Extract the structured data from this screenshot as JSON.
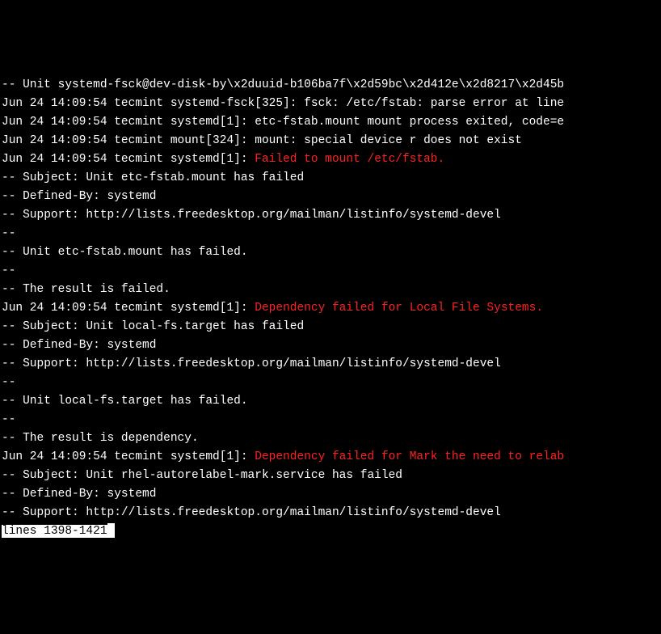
{
  "lines": [
    {
      "segments": [
        {
          "text": "-- Unit systemd-fsck@dev-disk-by\\x2duuid-b106ba7f\\x2d59bc\\x2d412e\\x2d8217\\x2d45b"
        }
      ]
    },
    {
      "segments": [
        {
          "text": "Jun 24 14:09:54 tecmint systemd-fsck[325]: fsck: /etc/fstab: parse error at line"
        }
      ]
    },
    {
      "segments": [
        {
          "text": "Jun 24 14:09:54 tecmint systemd[1]: etc-fstab.mount mount process exited, code=e"
        }
      ]
    },
    {
      "segments": [
        {
          "text": "Jun 24 14:09:54 tecmint mount[324]: mount: special device r does not exist"
        }
      ]
    },
    {
      "segments": [
        {
          "text": "Jun 24 14:09:54 tecmint systemd[1]: "
        },
        {
          "text": "Failed to mount /etc/fstab.",
          "class": "red"
        }
      ]
    },
    {
      "segments": [
        {
          "text": "-- Subject: Unit etc-fstab.mount has failed"
        }
      ]
    },
    {
      "segments": [
        {
          "text": "-- Defined-By: systemd"
        }
      ]
    },
    {
      "segments": [
        {
          "text": "-- Support: http://lists.freedesktop.org/mailman/listinfo/systemd-devel"
        }
      ]
    },
    {
      "segments": [
        {
          "text": "--"
        }
      ]
    },
    {
      "segments": [
        {
          "text": "-- Unit etc-fstab.mount has failed."
        }
      ]
    },
    {
      "segments": [
        {
          "text": "--"
        }
      ]
    },
    {
      "segments": [
        {
          "text": "-- The result is failed."
        }
      ]
    },
    {
      "segments": [
        {
          "text": "Jun 24 14:09:54 tecmint systemd[1]: "
        },
        {
          "text": "Dependency failed for Local File Systems.",
          "class": "red"
        }
      ]
    },
    {
      "segments": [
        {
          "text": "-- Subject: Unit local-fs.target has failed"
        }
      ]
    },
    {
      "segments": [
        {
          "text": "-- Defined-By: systemd"
        }
      ]
    },
    {
      "segments": [
        {
          "text": "-- Support: http://lists.freedesktop.org/mailman/listinfo/systemd-devel"
        }
      ]
    },
    {
      "segments": [
        {
          "text": "--"
        }
      ]
    },
    {
      "segments": [
        {
          "text": "-- Unit local-fs.target has failed."
        }
      ]
    },
    {
      "segments": [
        {
          "text": "--"
        }
      ]
    },
    {
      "segments": [
        {
          "text": "-- The result is dependency."
        }
      ]
    },
    {
      "segments": [
        {
          "text": "Jun 24 14:09:54 tecmint systemd[1]: "
        },
        {
          "text": "Dependency failed for Mark the need to relab",
          "class": "red"
        }
      ]
    },
    {
      "segments": [
        {
          "text": "-- Subject: Unit rhel-autorelabel-mark.service has failed"
        }
      ]
    },
    {
      "segments": [
        {
          "text": "-- Defined-By: systemd"
        }
      ]
    },
    {
      "segments": [
        {
          "text": "-- Support: http://lists.freedesktop.org/mailman/listinfo/systemd-devel"
        }
      ]
    }
  ],
  "status": "lines 1398-1421"
}
